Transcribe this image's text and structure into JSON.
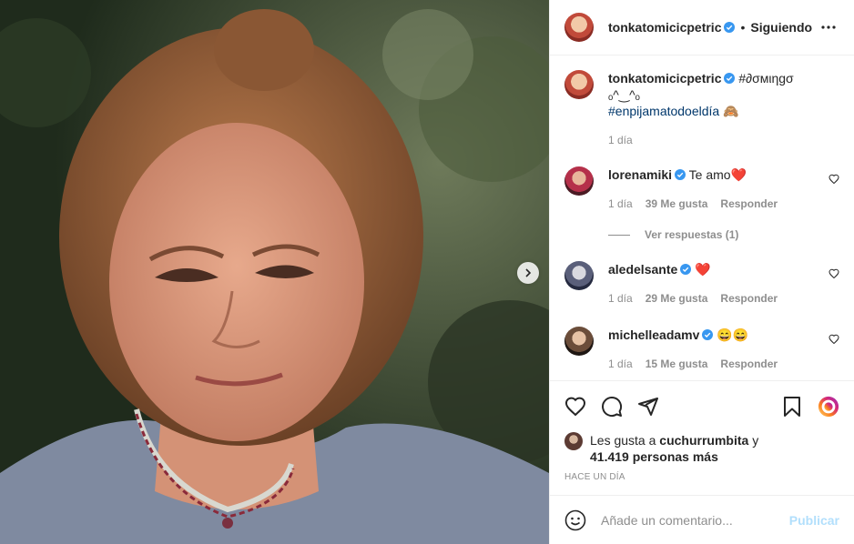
{
  "owner": {
    "username": "tonkatomicicpetric",
    "follow_label": "Siguiendo",
    "separator": "•"
  },
  "caption": {
    "username": "tonkatomicicpetric",
    "text": "#∂σмιηgσ",
    "line2": "ₒ^‿^ₒ",
    "hashtag": "#enpijamatodoeldía",
    "hashtag_emoji": "🙈",
    "time": "1 día"
  },
  "comments": [
    {
      "username": "lorenamiki",
      "text": "Te amo",
      "emoji": "❤️",
      "time": "1 día",
      "likes": "39 Me gusta",
      "reply": "Responder"
    },
    {
      "username": "aledelsante",
      "text": "",
      "emoji": "❤️",
      "time": "1 día",
      "likes": "29 Me gusta",
      "reply": "Responder"
    },
    {
      "username": "michelleadamv",
      "text": "",
      "emoji": "😄😄",
      "time": "1 día",
      "likes": "15 Me gusta",
      "reply": "Responder"
    }
  ],
  "view_replies": "Ver respuestas (1)",
  "likes": {
    "prefix": "Les gusta a",
    "user": "cuchurrumbita",
    "connector": "y",
    "count": "41.419 personas más"
  },
  "posted": "HACE UN DÍA",
  "comment_input": {
    "placeholder": "Añade un comentario...",
    "publish": "Publicar"
  },
  "colors": {
    "link": "#00376b",
    "verified": "#3897f0",
    "heart": "#ed4956",
    "publish_disabled": "#b2dffc"
  }
}
